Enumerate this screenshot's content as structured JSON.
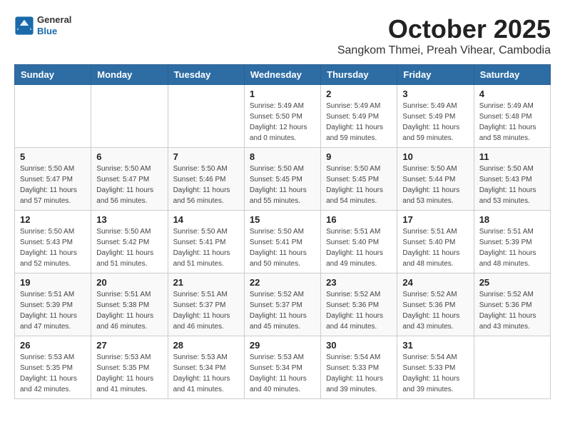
{
  "header": {
    "logo": {
      "general": "General",
      "blue": "Blue"
    },
    "month": "October 2025",
    "location": "Sangkom Thmei, Preah Vihear, Cambodia"
  },
  "weekdays": [
    "Sunday",
    "Monday",
    "Tuesday",
    "Wednesday",
    "Thursday",
    "Friday",
    "Saturday"
  ],
  "weeks": [
    [
      {
        "day": "",
        "info": ""
      },
      {
        "day": "",
        "info": ""
      },
      {
        "day": "",
        "info": ""
      },
      {
        "day": "1",
        "info": "Sunrise: 5:49 AM\nSunset: 5:50 PM\nDaylight: 12 hours\nand 0 minutes."
      },
      {
        "day": "2",
        "info": "Sunrise: 5:49 AM\nSunset: 5:49 PM\nDaylight: 11 hours\nand 59 minutes."
      },
      {
        "day": "3",
        "info": "Sunrise: 5:49 AM\nSunset: 5:49 PM\nDaylight: 11 hours\nand 59 minutes."
      },
      {
        "day": "4",
        "info": "Sunrise: 5:49 AM\nSunset: 5:48 PM\nDaylight: 11 hours\nand 58 minutes."
      }
    ],
    [
      {
        "day": "5",
        "info": "Sunrise: 5:50 AM\nSunset: 5:47 PM\nDaylight: 11 hours\nand 57 minutes."
      },
      {
        "day": "6",
        "info": "Sunrise: 5:50 AM\nSunset: 5:47 PM\nDaylight: 11 hours\nand 56 minutes."
      },
      {
        "day": "7",
        "info": "Sunrise: 5:50 AM\nSunset: 5:46 PM\nDaylight: 11 hours\nand 56 minutes."
      },
      {
        "day": "8",
        "info": "Sunrise: 5:50 AM\nSunset: 5:45 PM\nDaylight: 11 hours\nand 55 minutes."
      },
      {
        "day": "9",
        "info": "Sunrise: 5:50 AM\nSunset: 5:45 PM\nDaylight: 11 hours\nand 54 minutes."
      },
      {
        "day": "10",
        "info": "Sunrise: 5:50 AM\nSunset: 5:44 PM\nDaylight: 11 hours\nand 53 minutes."
      },
      {
        "day": "11",
        "info": "Sunrise: 5:50 AM\nSunset: 5:43 PM\nDaylight: 11 hours\nand 53 minutes."
      }
    ],
    [
      {
        "day": "12",
        "info": "Sunrise: 5:50 AM\nSunset: 5:43 PM\nDaylight: 11 hours\nand 52 minutes."
      },
      {
        "day": "13",
        "info": "Sunrise: 5:50 AM\nSunset: 5:42 PM\nDaylight: 11 hours\nand 51 minutes."
      },
      {
        "day": "14",
        "info": "Sunrise: 5:50 AM\nSunset: 5:41 PM\nDaylight: 11 hours\nand 51 minutes."
      },
      {
        "day": "15",
        "info": "Sunrise: 5:50 AM\nSunset: 5:41 PM\nDaylight: 11 hours\nand 50 minutes."
      },
      {
        "day": "16",
        "info": "Sunrise: 5:51 AM\nSunset: 5:40 PM\nDaylight: 11 hours\nand 49 minutes."
      },
      {
        "day": "17",
        "info": "Sunrise: 5:51 AM\nSunset: 5:40 PM\nDaylight: 11 hours\nand 48 minutes."
      },
      {
        "day": "18",
        "info": "Sunrise: 5:51 AM\nSunset: 5:39 PM\nDaylight: 11 hours\nand 48 minutes."
      }
    ],
    [
      {
        "day": "19",
        "info": "Sunrise: 5:51 AM\nSunset: 5:39 PM\nDaylight: 11 hours\nand 47 minutes."
      },
      {
        "day": "20",
        "info": "Sunrise: 5:51 AM\nSunset: 5:38 PM\nDaylight: 11 hours\nand 46 minutes."
      },
      {
        "day": "21",
        "info": "Sunrise: 5:51 AM\nSunset: 5:37 PM\nDaylight: 11 hours\nand 46 minutes."
      },
      {
        "day": "22",
        "info": "Sunrise: 5:52 AM\nSunset: 5:37 PM\nDaylight: 11 hours\nand 45 minutes."
      },
      {
        "day": "23",
        "info": "Sunrise: 5:52 AM\nSunset: 5:36 PM\nDaylight: 11 hours\nand 44 minutes."
      },
      {
        "day": "24",
        "info": "Sunrise: 5:52 AM\nSunset: 5:36 PM\nDaylight: 11 hours\nand 43 minutes."
      },
      {
        "day": "25",
        "info": "Sunrise: 5:52 AM\nSunset: 5:36 PM\nDaylight: 11 hours\nand 43 minutes."
      }
    ],
    [
      {
        "day": "26",
        "info": "Sunrise: 5:53 AM\nSunset: 5:35 PM\nDaylight: 11 hours\nand 42 minutes."
      },
      {
        "day": "27",
        "info": "Sunrise: 5:53 AM\nSunset: 5:35 PM\nDaylight: 11 hours\nand 41 minutes."
      },
      {
        "day": "28",
        "info": "Sunrise: 5:53 AM\nSunset: 5:34 PM\nDaylight: 11 hours\nand 41 minutes."
      },
      {
        "day": "29",
        "info": "Sunrise: 5:53 AM\nSunset: 5:34 PM\nDaylight: 11 hours\nand 40 minutes."
      },
      {
        "day": "30",
        "info": "Sunrise: 5:54 AM\nSunset: 5:33 PM\nDaylight: 11 hours\nand 39 minutes."
      },
      {
        "day": "31",
        "info": "Sunrise: 5:54 AM\nSunset: 5:33 PM\nDaylight: 11 hours\nand 39 minutes."
      },
      {
        "day": "",
        "info": ""
      }
    ]
  ]
}
